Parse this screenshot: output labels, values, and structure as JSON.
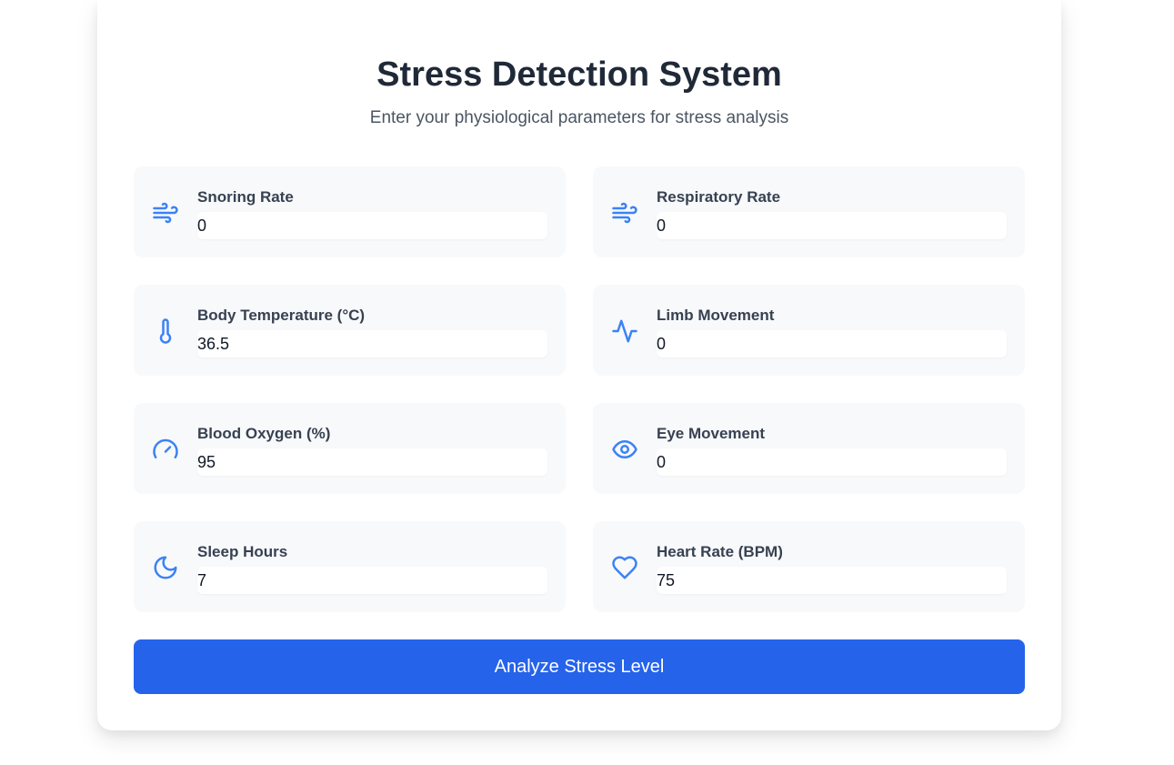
{
  "header": {
    "title": "Stress Detection System",
    "subtitle": "Enter your physiological parameters for stress analysis"
  },
  "fields": [
    {
      "label": "Snoring Rate",
      "value": "0",
      "icon": "wind-icon"
    },
    {
      "label": "Respiratory Rate",
      "value": "0",
      "icon": "wind-icon"
    },
    {
      "label": "Body Temperature (°C)",
      "value": "36.5",
      "icon": "thermometer-icon"
    },
    {
      "label": "Limb Movement",
      "value": "0",
      "icon": "activity-icon"
    },
    {
      "label": "Blood Oxygen (%)",
      "value": "95",
      "icon": "gauge-icon"
    },
    {
      "label": "Eye Movement",
      "value": "0",
      "icon": "eye-icon"
    },
    {
      "label": "Sleep Hours",
      "value": "7",
      "icon": "moon-icon"
    },
    {
      "label": "Heart Rate (BPM)",
      "value": "75",
      "icon": "heart-icon"
    }
  ],
  "actions": {
    "analyze_label": "Analyze Stress Level"
  },
  "colors": {
    "accent": "#3b82f6",
    "button": "#2563eb",
    "field_bg": "#f8f9fb",
    "title": "#1f2937"
  }
}
